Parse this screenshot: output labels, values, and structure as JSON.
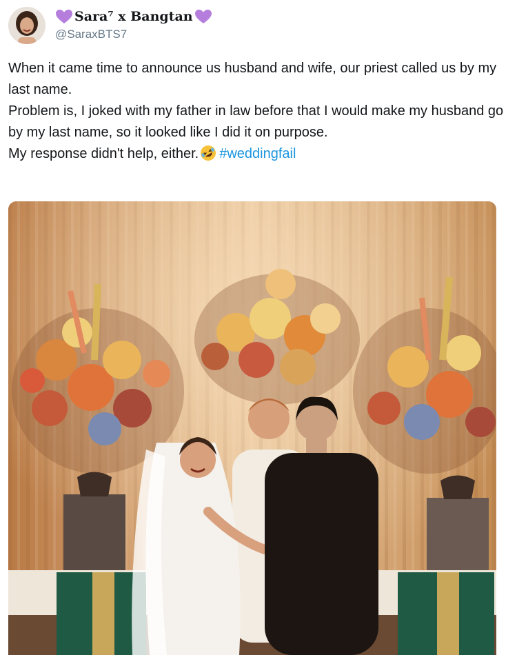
{
  "user": {
    "display_name": "Sara⁷ x Bangtan",
    "handle": "@SaraxBTS7",
    "avatar_icon": "avatar-woman",
    "heart_color": "#b57edc"
  },
  "tweet": {
    "lines": [
      "When it came time to announce us husband and wife, our priest called us by my last name.",
      "Problem is, I joked with my father in law before that I would make my husband go by my last name, so it looked like I did it on purpose."
    ],
    "last_line": "My response didn't help, either.",
    "emoji_icon": "rolling-on-floor-laughing-emoji",
    "hashtag": "#weddingfail",
    "hashtag_color": "#1b95e0"
  },
  "media": {
    "icon": "wedding-photo"
  }
}
